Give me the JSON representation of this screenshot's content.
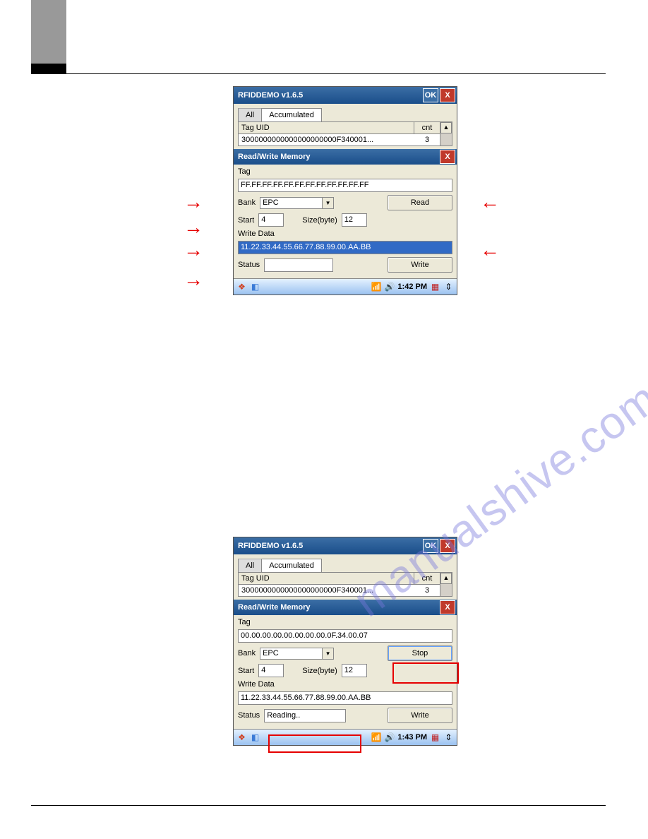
{
  "watermark": "manualshive.com",
  "screenshot1": {
    "title": "RFIDDEMO v1.6.5",
    "ok_label": "OK",
    "close_label": "X",
    "tabs": {
      "all": "All",
      "accumulated": "Accumulated"
    },
    "table": {
      "header_uid": "Tag UID",
      "header_cnt": "cnt",
      "row1_uid": "3000000000000000000000F340001...",
      "row1_cnt": "3",
      "row2_uid": "",
      "row2_cnt": ""
    },
    "dialog": {
      "title": "Read/Write Memory",
      "tag_label": "Tag",
      "tag_value": "FF.FF.FF.FF.FF.FF.FF.FF.FF.FF.FF.FF",
      "bank_label": "Bank",
      "bank_value": "EPC",
      "read_label": "Read",
      "start_label": "Start",
      "start_value": "4",
      "size_label": "Size(byte)",
      "size_value": "12",
      "writedata_label": "Write Data",
      "writedata_value": "11.22.33.44.55.66.77.88.99.00.AA.BB",
      "status_label": "Status",
      "status_value": "",
      "write_label": "Write"
    },
    "taskbar": {
      "clock": "1:42 PM"
    }
  },
  "screenshot2": {
    "title": "RFIDDEMO v1.6.5",
    "ok_label": "OK",
    "close_label": "X",
    "tabs": {
      "all": "All",
      "accumulated": "Accumulated"
    },
    "table": {
      "header_uid": "Tag UID",
      "header_cnt": "cnt",
      "row1_uid": "3000000000000000000000F340001...",
      "row1_cnt": "3"
    },
    "dialog": {
      "title": "Read/Write Memory",
      "tag_label": "Tag",
      "tag_value": "00.00.00.00.00.00.00.00.0F.34.00.07",
      "bank_label": "Bank",
      "bank_value": "EPC",
      "stop_label": "Stop",
      "start_label": "Start",
      "start_value": "4",
      "size_label": "Size(byte)",
      "size_value": "12",
      "writedata_label": "Write Data",
      "writedata_value": "11.22.33.44.55.66.77.88.99.00.AA.BB",
      "status_label": "Status",
      "status_value": "Reading..",
      "write_label": "Write"
    },
    "taskbar": {
      "clock": "1:43 PM"
    }
  }
}
